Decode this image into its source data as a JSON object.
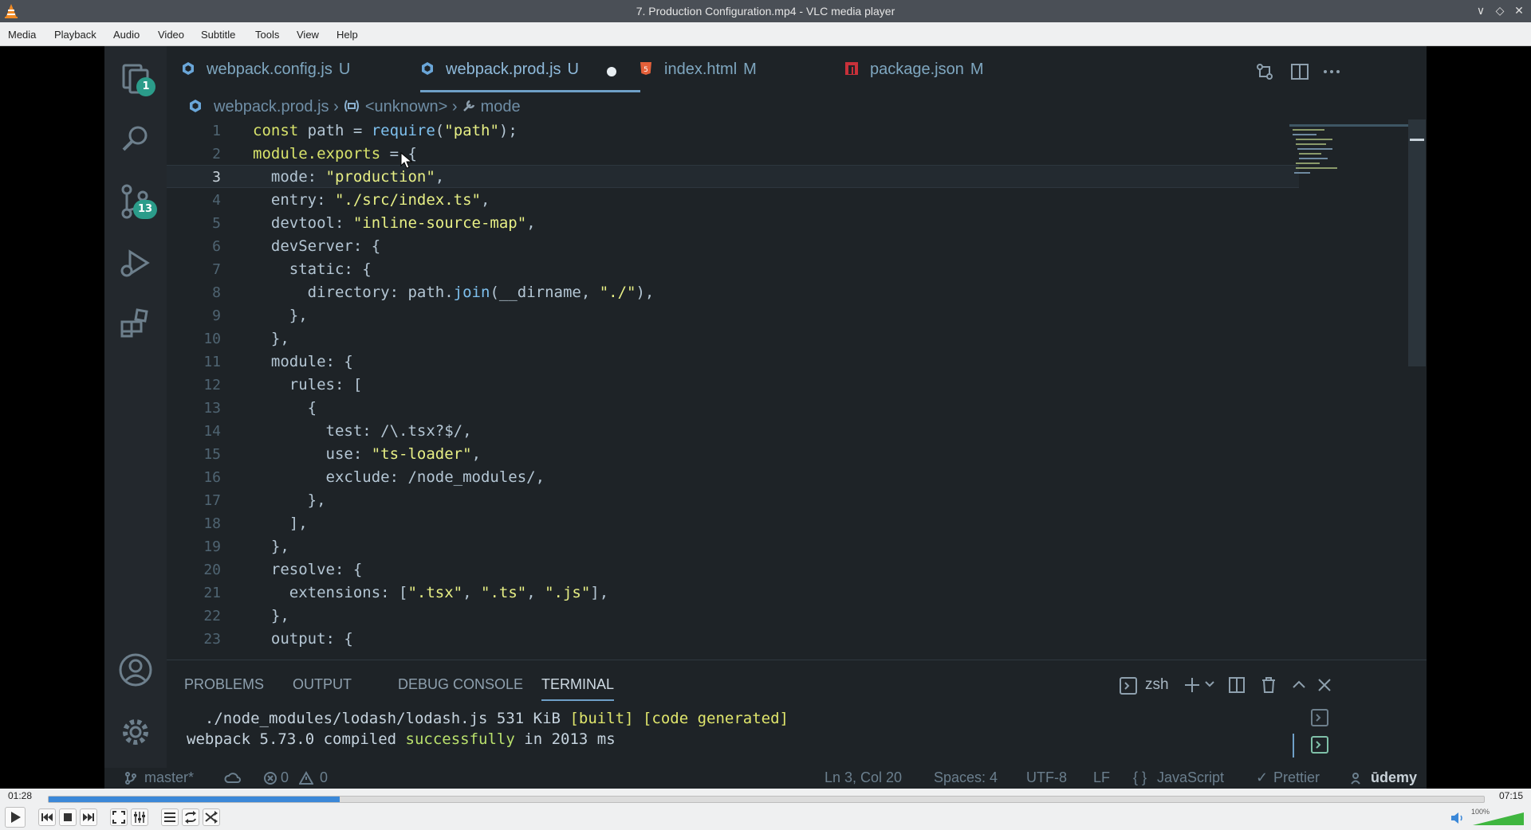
{
  "window": {
    "title": "7. Production Configuration.mp4 - VLC media player"
  },
  "menu": [
    "Media",
    "Playback",
    "Audio",
    "Video",
    "Subtitle",
    "Tools",
    "View",
    "Help"
  ],
  "editor": {
    "tabs": [
      {
        "label": "webpack.config.js",
        "status": "U",
        "icon": "webpack-icon"
      },
      {
        "label": "webpack.prod.js",
        "status": "U",
        "icon": "webpack-icon",
        "active": true,
        "modified_dot": true
      },
      {
        "label": "index.html",
        "status": "M",
        "icon": "html5-icon"
      },
      {
        "label": "package.json",
        "status": "M",
        "icon": "npm-icon"
      }
    ],
    "activity_badges": {
      "explorer": "1",
      "source_control": "13"
    },
    "breadcrumb": [
      "webpack.prod.js",
      "<unknown>",
      "mode"
    ],
    "lines": [
      {
        "n": "1",
        "text": "const path = require(\"path\");"
      },
      {
        "n": "2",
        "text": "module.exports = {"
      },
      {
        "n": "3",
        "text": "  mode: \"production\","
      },
      {
        "n": "4",
        "text": "  entry: \"./src/index.ts\","
      },
      {
        "n": "5",
        "text": "  devtool: \"inline-source-map\","
      },
      {
        "n": "6",
        "text": "  devServer: {"
      },
      {
        "n": "7",
        "text": "    static: {"
      },
      {
        "n": "8",
        "text": "      directory: path.join(__dirname, \"./\"),"
      },
      {
        "n": "9",
        "text": "    },"
      },
      {
        "n": "10",
        "text": "  },"
      },
      {
        "n": "11",
        "text": "  module: {"
      },
      {
        "n": "12",
        "text": "    rules: ["
      },
      {
        "n": "13",
        "text": "      {"
      },
      {
        "n": "14",
        "text": "        test: /\\.tsx?$/,"
      },
      {
        "n": "15",
        "text": "        use: \"ts-loader\","
      },
      {
        "n": "16",
        "text": "        exclude: /node_modules/,"
      },
      {
        "n": "17",
        "text": "      },"
      },
      {
        "n": "18",
        "text": "    ],"
      },
      {
        "n": "19",
        "text": "  },"
      },
      {
        "n": "20",
        "text": "  resolve: {"
      },
      {
        "n": "21",
        "text": "    extensions: [\".tsx\", \".ts\", \".js\"],"
      },
      {
        "n": "22",
        "text": "  },"
      },
      {
        "n": "23",
        "text": "  output: {"
      }
    ],
    "current_line": "3"
  },
  "panel": {
    "tabs": [
      "PROBLEMS",
      "OUTPUT",
      "DEBUG CONSOLE",
      "TERMINAL"
    ],
    "active_tab": "TERMINAL",
    "shell": "zsh",
    "terminal_lines": [
      {
        "pre": "  ./node_modules/lodash/lodash.js 531 KiB ",
        "built": "[built]",
        "gen": "[code generated]"
      },
      {
        "pre": "webpack 5.73.0 compiled ",
        "ok": "successfully",
        "post": " in 2013 ms"
      }
    ]
  },
  "statusbar": {
    "branch": "master*",
    "errors": "0",
    "warnings": "0",
    "position": "Ln 3, Col 20",
    "spaces": "Spaces: 4",
    "encoding": "UTF-8",
    "eol": "LF",
    "language": "JavaScript",
    "formatter": "Prettier",
    "watermark": "ūdemy"
  },
  "player": {
    "elapsed": "01:28",
    "total": "07:15",
    "progress": 0.203,
    "volume_label": "100%",
    "volume": 1.0
  },
  "colors": {
    "vlc_orange": "#f08a24",
    "seek_fill": "#3b88d8",
    "badge": "#2b9c8a"
  }
}
